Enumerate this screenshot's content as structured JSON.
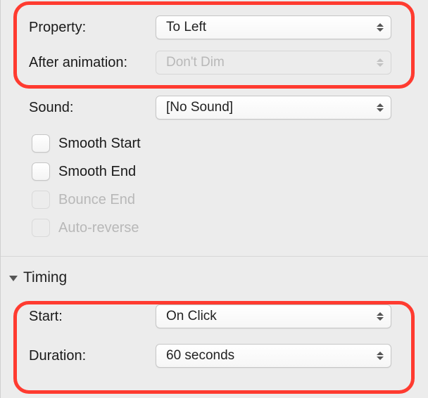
{
  "effect_options": {
    "property_label": "Property:",
    "property_value": "To Left",
    "after_animation_label": "After animation:",
    "after_animation_value": "Don't Dim",
    "sound_label": "Sound:",
    "sound_value": "[No Sound]",
    "checkboxes": {
      "smooth_start": "Smooth Start",
      "smooth_end": "Smooth End",
      "bounce_end": "Bounce End",
      "auto_reverse": "Auto-reverse"
    }
  },
  "timing": {
    "header": "Timing",
    "start_label": "Start:",
    "start_value": "On Click",
    "duration_label": "Duration:",
    "duration_value": "60 seconds"
  }
}
